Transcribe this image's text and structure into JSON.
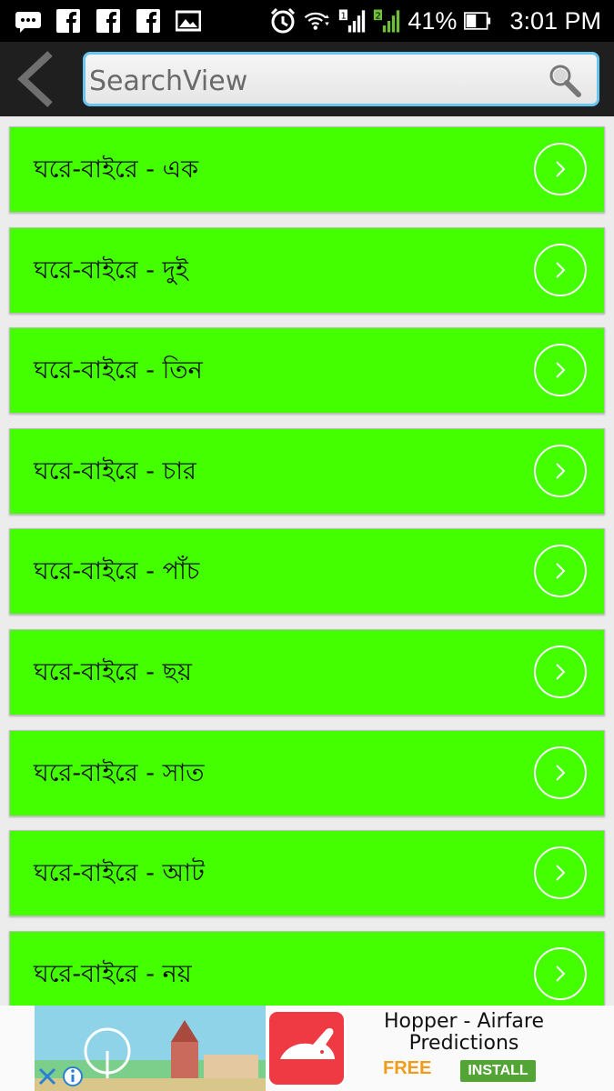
{
  "status_bar": {
    "battery": "41%",
    "time": "3:01 PM",
    "icons": [
      "message-icon",
      "facebook-icon",
      "facebook-icon",
      "facebook-icon",
      "image-icon",
      "alarm-icon",
      "wifi-icon",
      "signal-sim1-icon",
      "signal-sim2-icon",
      "battery-icon"
    ]
  },
  "action_bar": {
    "search_placeholder": "SearchView"
  },
  "list": {
    "items": [
      {
        "label": "ঘরে-বাইরে - এক"
      },
      {
        "label": "ঘরে-বাইরে - দুই"
      },
      {
        "label": "ঘরে-বাইরে - তিন"
      },
      {
        "label": "ঘরে-বাইরে - চার"
      },
      {
        "label": "ঘরে-বাইরে - পাঁচ"
      },
      {
        "label": "ঘরে-বাইরে - ছয়"
      },
      {
        "label": "ঘরে-বাইরে - সাত"
      },
      {
        "label": "ঘরে-বাইরে - আট"
      },
      {
        "label": "ঘরে-বাইরে - নয়"
      }
    ]
  },
  "ad": {
    "title": "Hopper - Airfare Predictions",
    "price": "FREE",
    "install_label": "INSTALL"
  },
  "colors": {
    "item_bg": "#44ff00",
    "search_border": "#68c6ee",
    "install_bg": "#52a435",
    "free_text": "#f29b1b"
  }
}
